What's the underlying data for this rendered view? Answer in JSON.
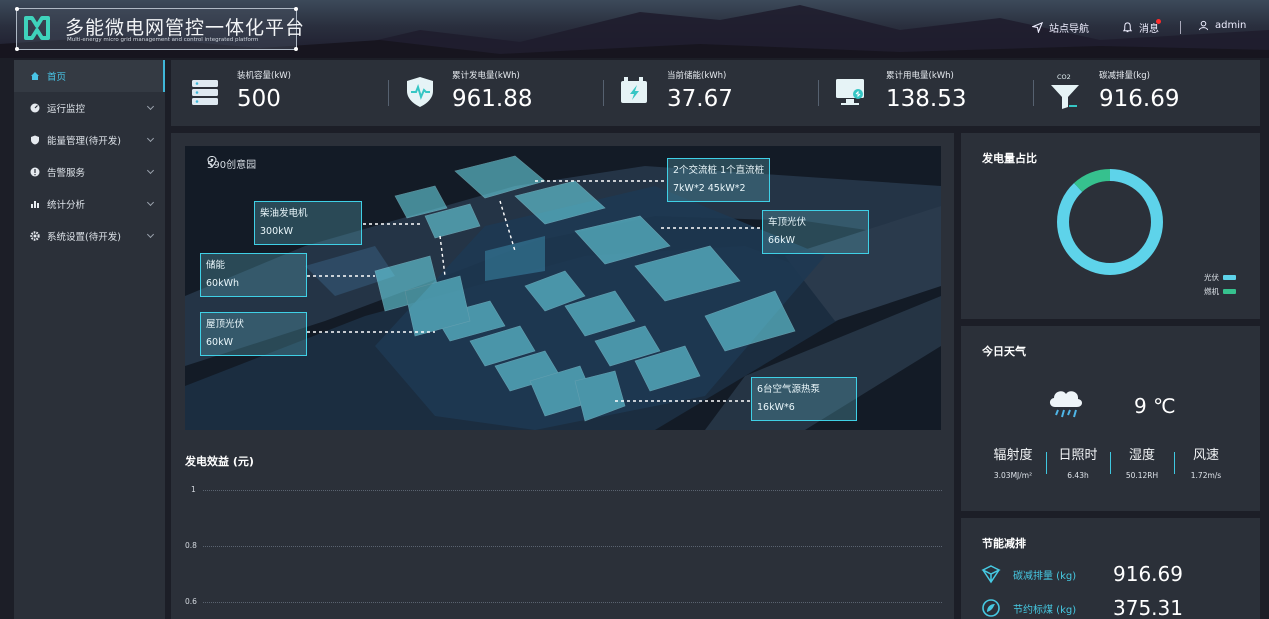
{
  "app": {
    "title": "多能微电网管控一体化平台",
    "subtitle": "Multi-energy micro grid management and control integrated platform"
  },
  "topnav": {
    "site_nav": "站点导航",
    "messages": "消息",
    "user": "admin"
  },
  "sidebar": {
    "items": [
      {
        "label": "首页",
        "icon": "home-icon",
        "active": true
      },
      {
        "label": "运行监控",
        "icon": "dashboard-icon"
      },
      {
        "label": "能量管理(待开发)",
        "icon": "shield-icon"
      },
      {
        "label": "告警服务",
        "icon": "alert-icon"
      },
      {
        "label": "统计分析",
        "icon": "bar-chart-icon"
      },
      {
        "label": "系统设置(待开发)",
        "icon": "gear-icon"
      }
    ]
  },
  "stats": [
    {
      "label": "装机容量(kW)",
      "value": "500",
      "icon": "server-icon"
    },
    {
      "label": "累计发电量(kWh)",
      "value": "961.88",
      "icon": "shield-pulse-icon"
    },
    {
      "label": "当前储能(kWh)",
      "value": "37.67",
      "icon": "battery-icon"
    },
    {
      "label": "累计用电量(kWh)",
      "value": "138.53",
      "icon": "monitor-icon"
    },
    {
      "label": "碳减排量(kg)",
      "value": "916.69",
      "icon": "co2-funnel-icon",
      "icon_text": "CO2"
    }
  ],
  "campus": {
    "location": "590创意园",
    "callouts": [
      {
        "line1": "2个交流桩 1个直流桩",
        "line2": "7kW*2   45kW*2"
      },
      {
        "line1": "柴油发电机",
        "line2": "300kW"
      },
      {
        "line1": "车顶光伏",
        "line2": "66kW"
      },
      {
        "line1": "储能",
        "line2": "60kWh"
      },
      {
        "line1": "屋顶光伏",
        "line2": "60kW"
      },
      {
        "line1": "6台空气源热泵",
        "line2": "16kW*6"
      }
    ]
  },
  "efficiency": {
    "title": "发电效益 (元)",
    "ticks": [
      "1",
      "0.8",
      "0.6"
    ]
  },
  "chart_data": {
    "type": "pie",
    "title": "发电量占比",
    "categories": [
      "光伏",
      "燃机"
    ],
    "values": [
      88,
      12
    ],
    "colors": [
      "#5ed3ea",
      "#36c18e"
    ],
    "legend": "bottom-right"
  },
  "weather": {
    "title": "今日天气",
    "temp": "9 ℃",
    "icon": "rain-cloud-icon",
    "items": [
      {
        "label": "辐射度",
        "value": "3.03MJ/m²"
      },
      {
        "label": "日照时",
        "value": "6.43h"
      },
      {
        "label": "湿度",
        "value": "50.12RH"
      },
      {
        "label": "风速",
        "value": "1.72m/s"
      }
    ]
  },
  "saving": {
    "title": "节能减排",
    "items": [
      {
        "label": "碳减排量 (kg)",
        "value": "916.69",
        "icon": "co2-cube-icon"
      },
      {
        "label": "节约标煤 (kg)",
        "value": "375.31",
        "icon": "coal-icon"
      }
    ]
  }
}
